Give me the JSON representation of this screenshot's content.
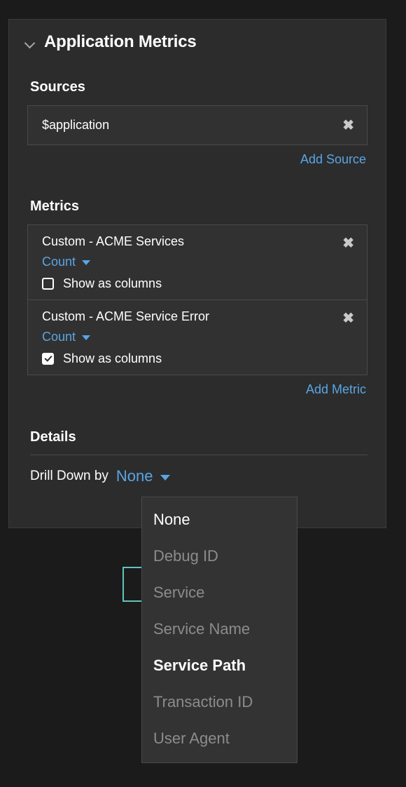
{
  "panel": {
    "title": "Application Metrics",
    "collapse_icon": "chevron-down-icon"
  },
  "sources": {
    "heading": "Sources",
    "items": [
      {
        "value": "$application",
        "remove_label": "✖"
      }
    ],
    "add_label": "Add Source"
  },
  "metrics": {
    "heading": "Metrics",
    "items": [
      {
        "name": "Custom - ACME Services",
        "aggregation": "Count",
        "show_as_columns_label": "Show as columns",
        "show_as_columns_checked": false,
        "remove_label": "✖"
      },
      {
        "name": "Custom - ACME Service Error",
        "aggregation": "Count",
        "show_as_columns_label": "Show as columns",
        "show_as_columns_checked": true,
        "remove_label": "✖"
      }
    ],
    "add_label": "Add Metric"
  },
  "details": {
    "heading": "Details",
    "drill_down_label": "Drill Down by",
    "drill_down_value": "None"
  },
  "dropdown": {
    "items": [
      {
        "label": "None",
        "enabled": true,
        "bold": false
      },
      {
        "label": "Debug ID",
        "enabled": false,
        "bold": false
      },
      {
        "label": "Service",
        "enabled": false,
        "bold": false
      },
      {
        "label": "Service Name",
        "enabled": false,
        "bold": false
      },
      {
        "label": "Service Path",
        "enabled": true,
        "bold": true
      },
      {
        "label": "Transaction ID",
        "enabled": false,
        "bold": false
      },
      {
        "label": "User Agent",
        "enabled": false,
        "bold": false
      }
    ]
  },
  "colors": {
    "accent_blue": "#59a5e5",
    "teal_outline": "#5fc5bf",
    "panel_bg": "#2c2c2c",
    "page_bg": "#1b1b1b"
  }
}
